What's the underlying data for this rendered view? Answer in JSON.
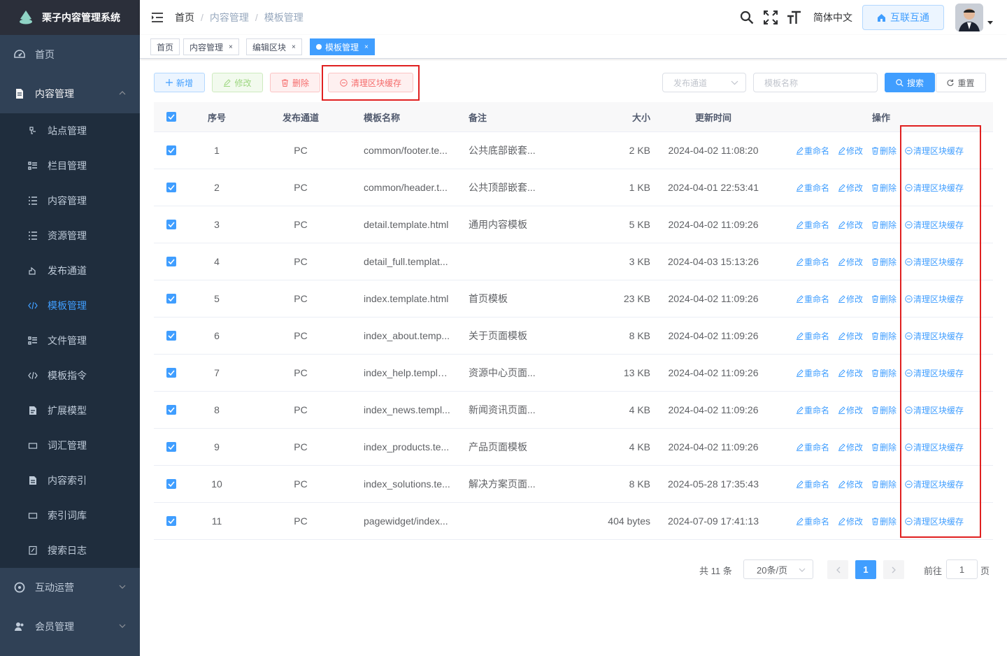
{
  "app": {
    "title": "栗子内容管理系统"
  },
  "sidebar": {
    "items": [
      {
        "label": "首页",
        "icon": "dashboard-icon"
      },
      {
        "label": "内容管理",
        "icon": "document-icon",
        "expanded": true
      },
      {
        "label": "互动运营",
        "icon": "interaction-icon"
      },
      {
        "label": "会员管理",
        "icon": "members-icon"
      }
    ],
    "sub_items": [
      {
        "label": "站点管理",
        "icon": "site-icon"
      },
      {
        "label": "栏目管理",
        "icon": "catalog-icon"
      },
      {
        "label": "内容管理",
        "icon": "list-icon"
      },
      {
        "label": "资源管理",
        "icon": "list-icon"
      },
      {
        "label": "发布通道",
        "icon": "publish-icon"
      },
      {
        "label": "模板管理",
        "icon": "code-icon",
        "active": true
      },
      {
        "label": "文件管理",
        "icon": "file-icon"
      },
      {
        "label": "模板指令",
        "icon": "code-icon"
      },
      {
        "label": "扩展模型",
        "icon": "model-icon"
      },
      {
        "label": "词汇管理",
        "icon": "word-icon"
      },
      {
        "label": "内容索引",
        "icon": "index-icon"
      },
      {
        "label": "索引词库",
        "icon": "word-icon"
      },
      {
        "label": "搜索日志",
        "icon": "log-icon"
      }
    ]
  },
  "header": {
    "breadcrumb": [
      "首页",
      "内容管理",
      "模板管理"
    ],
    "language": "简体中文",
    "hulian_button": "互联互通"
  },
  "tags": [
    {
      "label": "首页",
      "closable": false
    },
    {
      "label": "内容管理",
      "closable": true
    },
    {
      "label": "编辑区块",
      "closable": true
    },
    {
      "label": "模板管理",
      "closable": true,
      "active": true
    }
  ],
  "toolbar": {
    "add": "新增",
    "edit": "修改",
    "delete": "删除",
    "clear_cache": "清理区块缓存",
    "channel_placeholder": "发布通道",
    "name_placeholder": "模板名称",
    "search": "搜索",
    "reset": "重置"
  },
  "table": {
    "columns": [
      "序号",
      "发布通道",
      "模板名称",
      "备注",
      "大小",
      "更新时间",
      "操作"
    ],
    "ops": [
      "重命名",
      "修改",
      "删除",
      "清理区块缓存"
    ],
    "rows": [
      {
        "idx": "1",
        "channel": "PC",
        "name": "common/footer.te...",
        "note": "公共底部嵌套...",
        "size": "2 KB",
        "time": "2024-04-02 11:08:20"
      },
      {
        "idx": "2",
        "channel": "PC",
        "name": "common/header.t...",
        "note": "公共顶部嵌套...",
        "size": "1 KB",
        "time": "2024-04-01 22:53:41"
      },
      {
        "idx": "3",
        "channel": "PC",
        "name": "detail.template.html",
        "note": "通用内容模板",
        "size": "5 KB",
        "time": "2024-04-02 11:09:26"
      },
      {
        "idx": "4",
        "channel": "PC",
        "name": "detail_full.templat...",
        "note": "",
        "size": "3 KB",
        "time": "2024-04-03 15:13:26"
      },
      {
        "idx": "5",
        "channel": "PC",
        "name": "index.template.html",
        "note": "首页模板",
        "size": "23 KB",
        "time": "2024-04-02 11:09:26"
      },
      {
        "idx": "6",
        "channel": "PC",
        "name": "index_about.temp...",
        "note": "关于页面模板",
        "size": "8 KB",
        "time": "2024-04-02 11:09:26"
      },
      {
        "idx": "7",
        "channel": "PC",
        "name": "index_help.templa...",
        "note": "资源中心页面...",
        "size": "13 KB",
        "time": "2024-04-02 11:09:26"
      },
      {
        "idx": "8",
        "channel": "PC",
        "name": "index_news.templ...",
        "note": "新闻资讯页面...",
        "size": "4 KB",
        "time": "2024-04-02 11:09:26"
      },
      {
        "idx": "9",
        "channel": "PC",
        "name": "index_products.te...",
        "note": "产品页面模板",
        "size": "4 KB",
        "time": "2024-04-02 11:09:26"
      },
      {
        "idx": "10",
        "channel": "PC",
        "name": "index_solutions.te...",
        "note": "解决方案页面...",
        "size": "8 KB",
        "time": "2024-05-28 17:35:43"
      },
      {
        "idx": "11",
        "channel": "PC",
        "name": "pagewidget/index...",
        "note": "",
        "size": "404 bytes",
        "time": "2024-07-09 17:41:13"
      }
    ]
  },
  "pagination": {
    "total": "共 11 条",
    "page_size": "20条/页",
    "current": "1",
    "goto_label": "前往",
    "goto_value": "1",
    "page_suffix": "页"
  },
  "colors": {
    "primary": "#409eff",
    "sidebar_bg": "#304156",
    "highlight": "#e02020"
  }
}
